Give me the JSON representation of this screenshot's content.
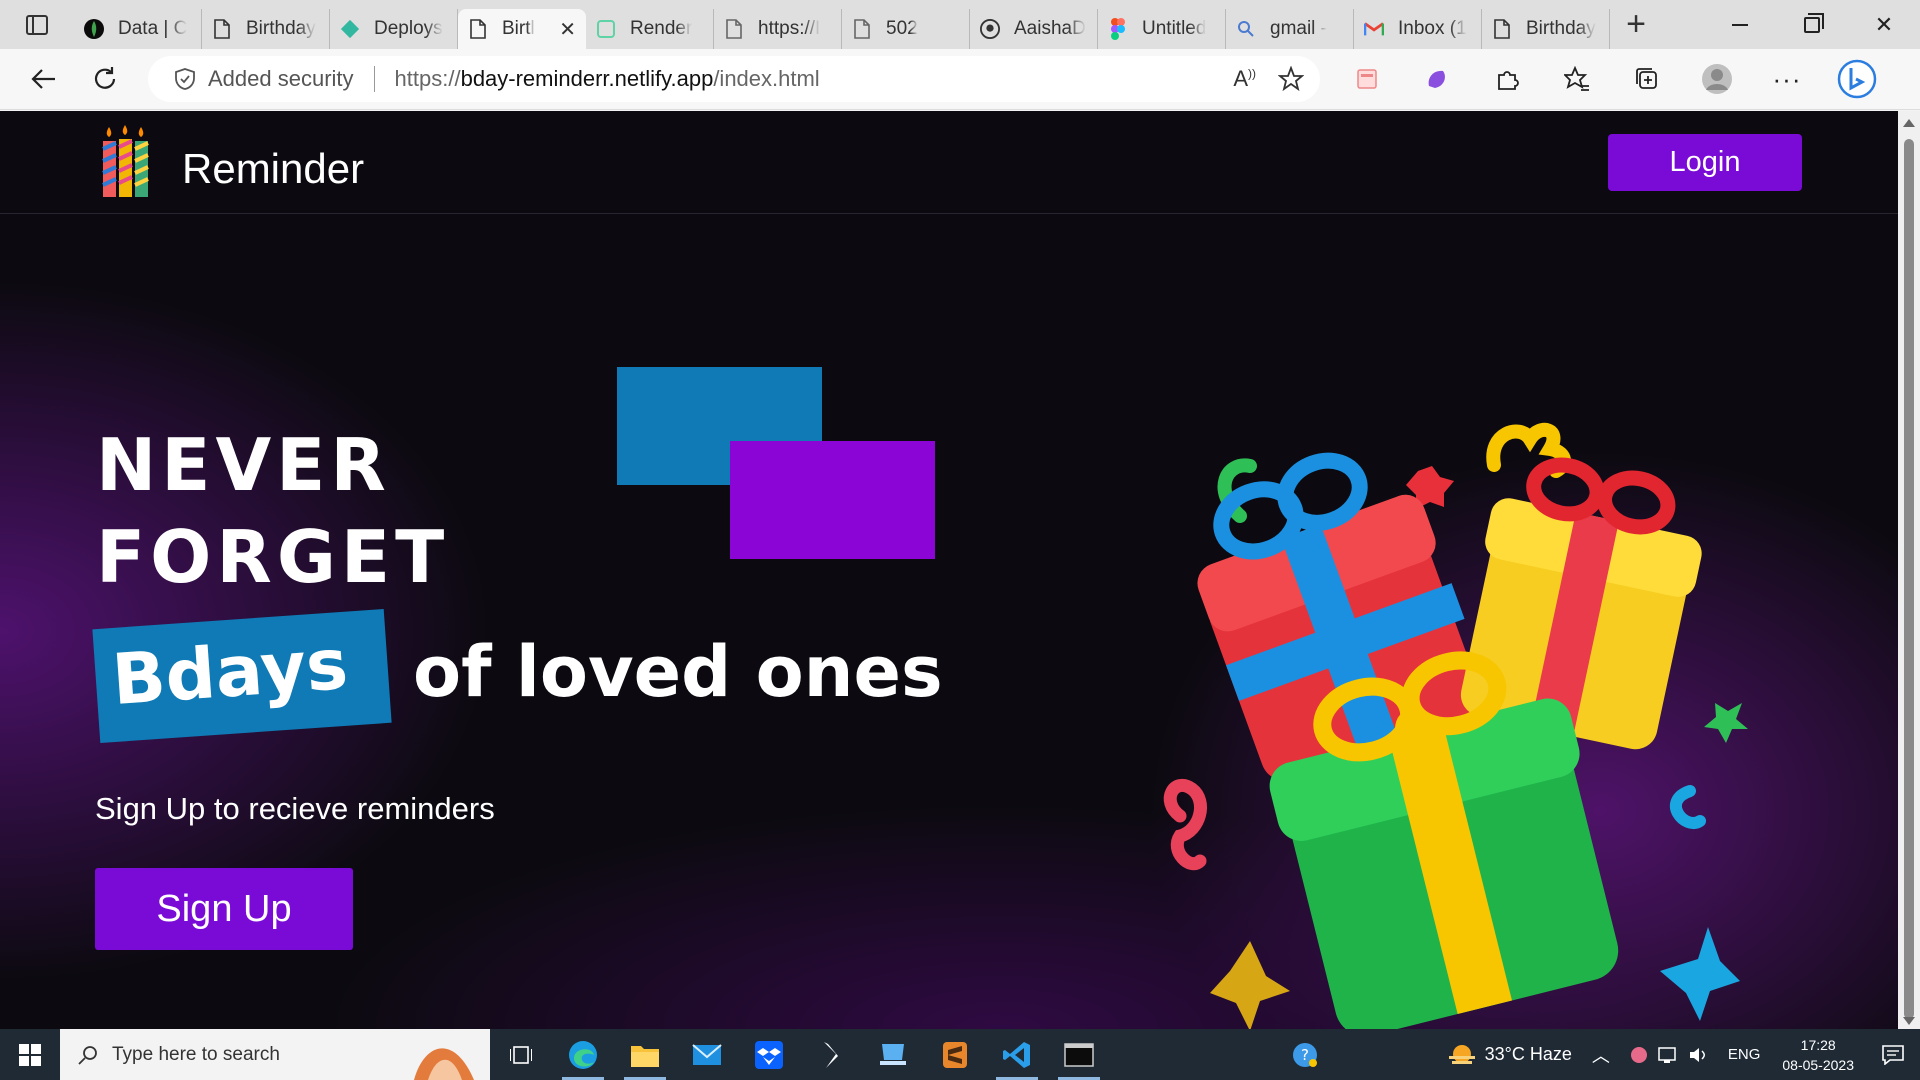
{
  "browser": {
    "tabs": [
      {
        "title": "Data | C",
        "icon": "mongodb-leaf-icon",
        "active": false
      },
      {
        "title": "Birthday",
        "icon": "page-icon",
        "active": false
      },
      {
        "title": "Deploys",
        "icon": "netlify-icon",
        "active": false
      },
      {
        "title": "Birtl",
        "icon": "page-icon",
        "active": true
      },
      {
        "title": "Render",
        "icon": "render-icon",
        "active": false
      },
      {
        "title": "https://I",
        "icon": "page-icon",
        "active": false
      },
      {
        "title": "502",
        "icon": "page-icon",
        "active": false
      },
      {
        "title": "AaishaD",
        "icon": "github-icon",
        "active": false
      },
      {
        "title": "Untitled",
        "icon": "figma-icon",
        "active": false
      },
      {
        "title": "gmail -",
        "icon": "search-icon",
        "active": false
      },
      {
        "title": "Inbox (1",
        "icon": "gmail-icon",
        "active": false
      },
      {
        "title": "Birthday",
        "icon": "page-icon",
        "active": false
      }
    ],
    "security_label": "Added security",
    "url_prefix": "https://",
    "url_host": "bday-reminderr.netlify.app",
    "url_path": "/index.html"
  },
  "page": {
    "brand": "Reminder",
    "login_label": "Login",
    "hero_line1": "NEVER",
    "hero_line2": "FORGET",
    "badge": "Bdays",
    "hero_rest": "of loved ones",
    "subtitle": "Sign Up to recieve reminders",
    "signup_label": "Sign Up",
    "colors": {
      "accent_purple": "#7a0ad6",
      "accent_blue": "#0f7ab5",
      "background": "#0c0a10"
    }
  },
  "taskbar": {
    "search_placeholder": "Type here to search",
    "weather": "33°C  Haze",
    "language": "ENG",
    "time": "17:28",
    "date": "08-05-2023"
  }
}
